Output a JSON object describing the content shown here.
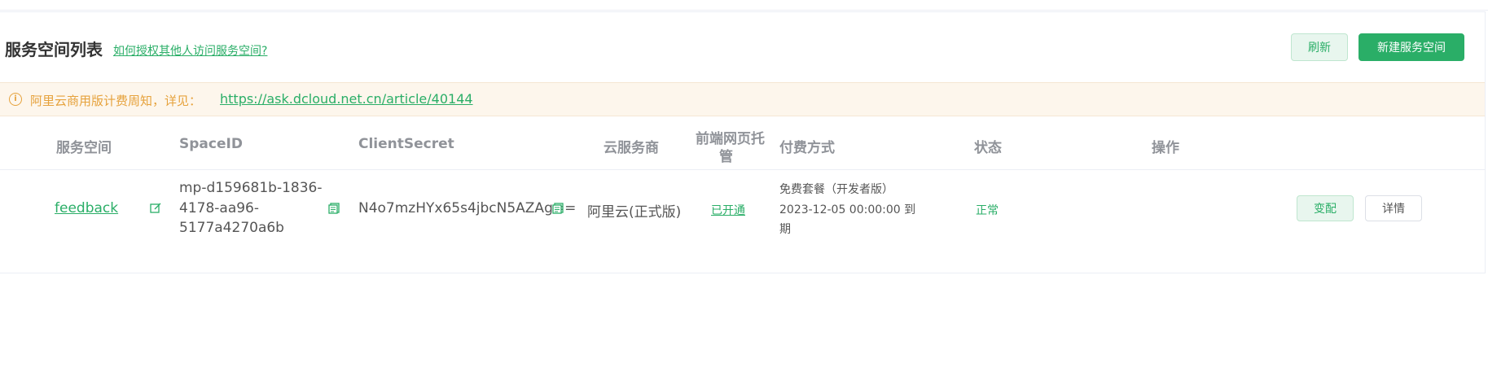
{
  "header": {
    "title": "服务空间列表",
    "help_link": "如何授权其他人访问服务空间?",
    "refresh_label": "刷新",
    "new_label": "新建服务空间"
  },
  "notice": {
    "text": "阿里云商用版计费周知，详见：",
    "link": "https://ask.dcloud.net.cn/article/40144"
  },
  "table": {
    "columns": [
      "服务空间",
      "SpaceID",
      "ClientSecret",
      "云服务商",
      "前端网页托",
      "管",
      "付费方式",
      "状态",
      "操作"
    ],
    "rows": [
      {
        "name": "feedback",
        "space_id_1": "mp-d159681b-1836-",
        "space_id_2": "4178-aa96-",
        "space_id_3": "5177a4270a6b",
        "client_secret": "N4o7mzHYx65s4jbcN5AZAg==",
        "provider": "阿里云(正式版)",
        "hosting": "已开通",
        "plan_1": "免费套餐（开发者版）",
        "plan_2": "2023-12-05 00:00:00 到",
        "plan_3": "期",
        "status": "正常",
        "change_label": "变配",
        "detail_label": "详情"
      }
    ]
  },
  "colors": {
    "accent": "#2aae67",
    "warning": "#e6a23c",
    "notice_bg": "#fdf6ec"
  },
  "icons": [
    "info-icon",
    "edit-icon",
    "copy-icon"
  ]
}
